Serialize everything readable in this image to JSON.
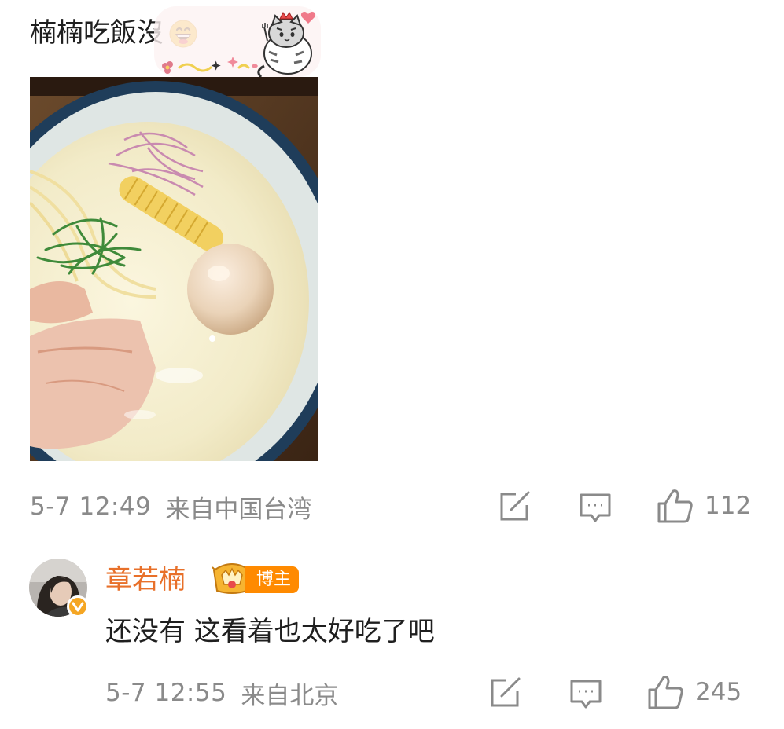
{
  "comment": {
    "text": "楠楠吃飯沒",
    "emoji_icon": "grinning-face-icon",
    "sticker_icon": "cat-sticker-icon",
    "photo_icon": "ramen-bowl-photo",
    "time": "5-7 12:49",
    "source": "来自中国台湾",
    "like_count": "112",
    "actions": {
      "share_icon": "share-edit-icon",
      "comment_icon": "comment-bubble-icon",
      "like_icon": "thumbs-up-icon"
    }
  },
  "reply": {
    "author": "章若楠",
    "badge_label": "博主",
    "badge_icon": "crown-fan-icon",
    "verify_icon": "verified-v-icon",
    "text": "还没有 这看着也太好吃了吧",
    "time": "5-7 12:55",
    "source": "来自北京",
    "like_count": "245"
  },
  "colors": {
    "meta_gray": "#8a8a8a",
    "name_orange": "#e8702a",
    "badge_orange": "#ff8a00",
    "text_dark": "#1f1f1f"
  }
}
